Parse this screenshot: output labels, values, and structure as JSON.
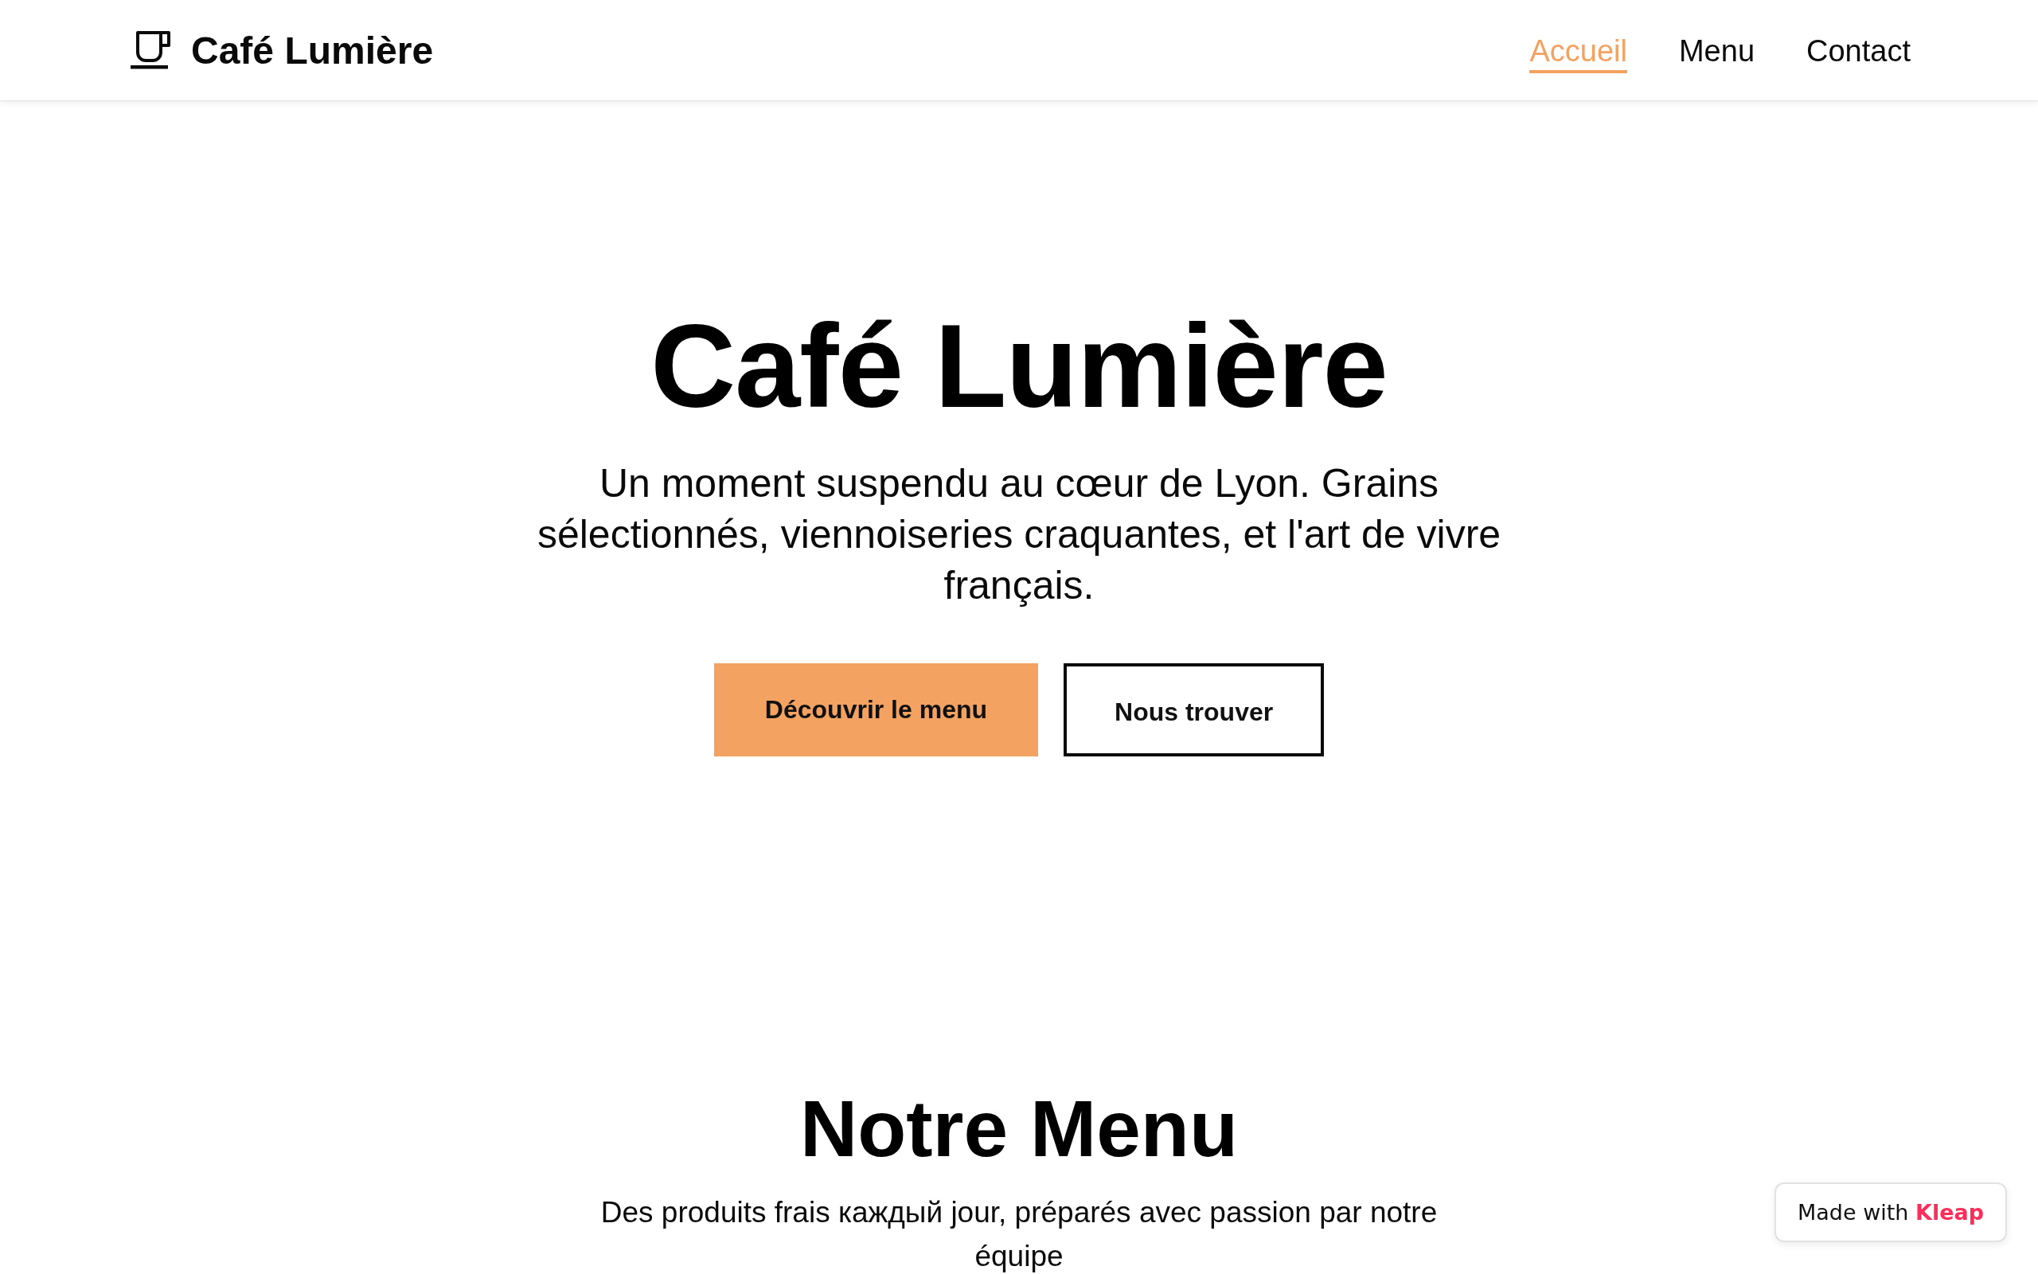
{
  "header": {
    "brand": {
      "name": "Café Lumière"
    },
    "nav": [
      {
        "label": "Accueil",
        "selected": true
      },
      {
        "label": "Menu",
        "selected": false
      },
      {
        "label": "Contact",
        "selected": false
      }
    ]
  },
  "hero": {
    "title": "Café Lumière",
    "subtitle": "Un moment suspendu au cœur de Lyon. Grains sélectionnés, viennoiseries craquantes, et l'art de vivre français.",
    "buttons": [
      {
        "label": "Découvrir le menu",
        "kind": "primary"
      },
      {
        "label": "Nous trouver",
        "kind": "outline"
      }
    ]
  },
  "menu_section": {
    "title": "Notre Menu",
    "subtitle": "Des produits frais каждый jour, préparés avec passion par notre équipe"
  },
  "badge": {
    "text": "Made with **Kleap**"
  }
}
